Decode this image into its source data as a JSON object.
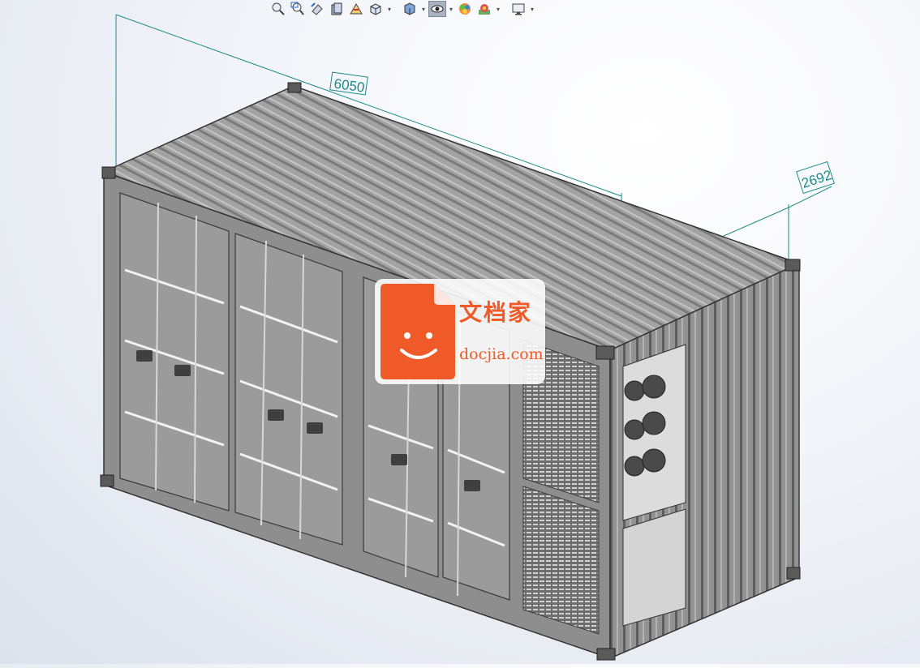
{
  "toolbar": {
    "buttons": [
      {
        "name": "zoom-to-fit-icon"
      },
      {
        "name": "zoom-to-area-icon"
      },
      {
        "name": "previous-view-icon"
      },
      {
        "name": "section-view-icon"
      },
      {
        "name": "dynamic-annotation-icon"
      },
      {
        "name": "view-orientation-icon",
        "dropdown": true
      },
      {
        "name": "display-style-icon",
        "dropdown": true
      },
      {
        "name": "hide-show-items-icon",
        "dropdown": true,
        "active": true
      },
      {
        "name": "edit-appearance-icon"
      },
      {
        "name": "apply-scene-icon",
        "dropdown": true
      },
      {
        "name": "view-settings-icon",
        "dropdown": true
      }
    ]
  },
  "dimensions": {
    "length": "6050",
    "height": "2692"
  },
  "watermark": {
    "chinese": "文档家",
    "site": "docjia.com"
  },
  "colors": {
    "dimension_line": "#1b8a8a",
    "body": "#8e8e8e",
    "roof": "#9a9a9a",
    "brand": "#f05a28"
  }
}
